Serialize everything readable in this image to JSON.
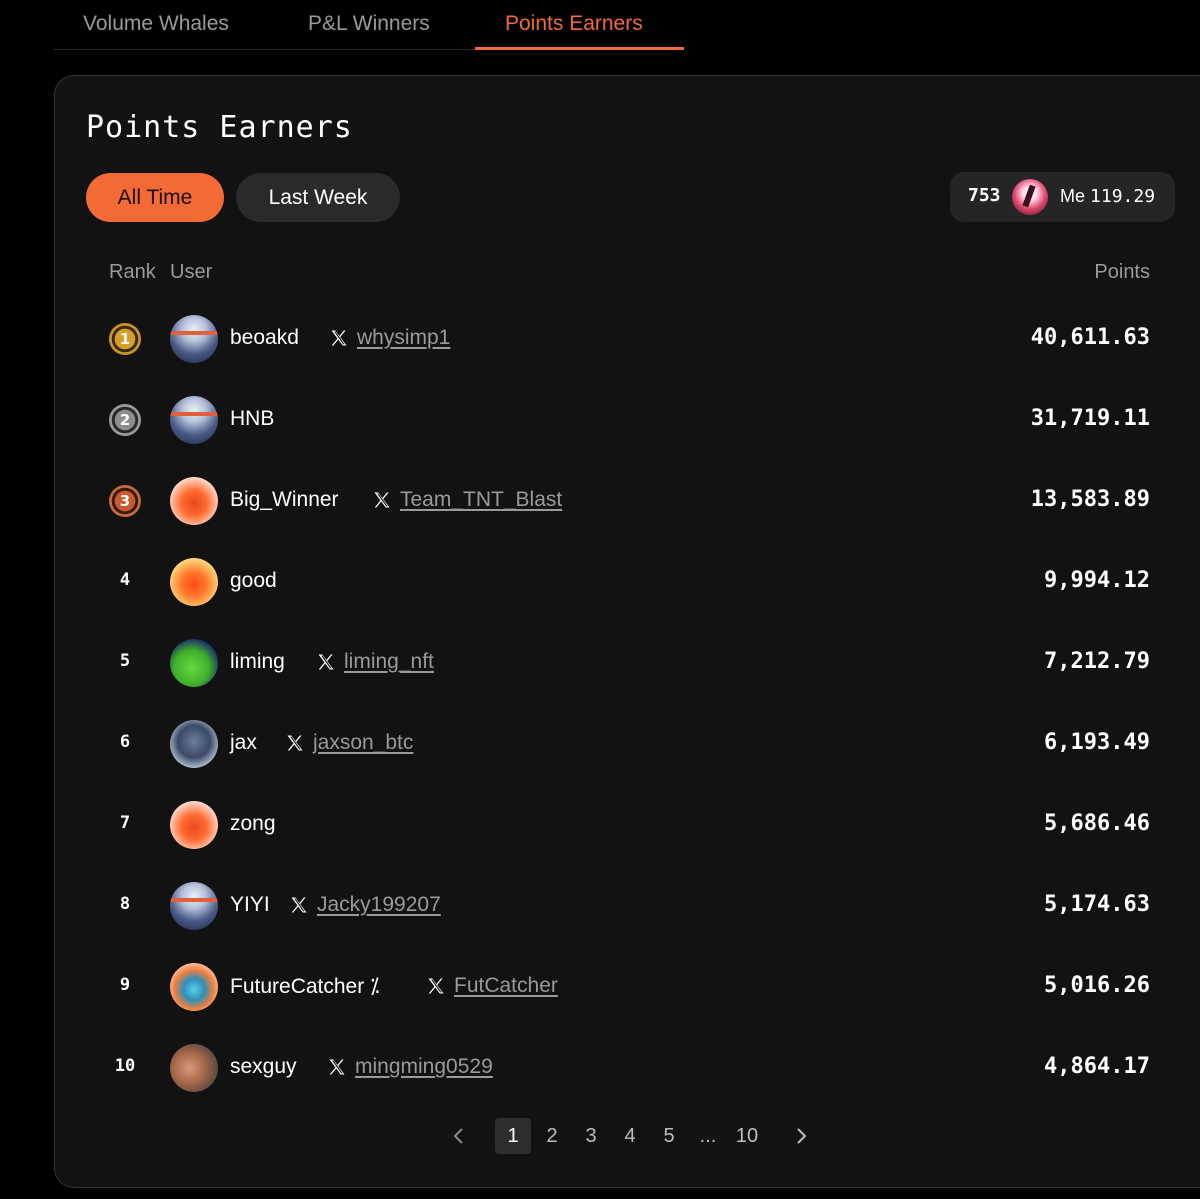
{
  "tabs": [
    {
      "label": "Volume Whales",
      "active": false
    },
    {
      "label": "P&L Winners",
      "active": false
    },
    {
      "label": "Points Earners",
      "active": true
    }
  ],
  "accent_color": "#f26a35",
  "card": {
    "title": "Points Earners",
    "filters": {
      "all_time": "All Time",
      "last_week": "Last Week",
      "selected": "All Time"
    },
    "me": {
      "rank": "753",
      "label": "Me",
      "score": "119.29"
    },
    "columns": {
      "rank": "Rank",
      "user": "User",
      "points": "Points"
    }
  },
  "rows": [
    {
      "rank": "1",
      "medal": "gold",
      "avatar": "ghost",
      "name": "beoakd",
      "x_handle": "whysimp1",
      "points": "40,611.63"
    },
    {
      "rank": "2",
      "medal": "silver",
      "avatar": "ghost",
      "name": "HNB",
      "x_handle": "",
      "points": "31,719.11"
    },
    {
      "rank": "3",
      "medal": "bronze",
      "avatar": "red-silhouette",
      "name": "Big_Winner",
      "x_handle": "Team_TNT_Blast",
      "points": "13,583.89"
    },
    {
      "rank": "4",
      "medal": "",
      "avatar": "yellow-silhouette",
      "name": "good",
      "x_handle": "",
      "points": "9,994.12"
    },
    {
      "rank": "5",
      "medal": "",
      "avatar": "frog",
      "name": "liming",
      "x_handle": "liming_nft",
      "points": "7,212.79"
    },
    {
      "rank": "6",
      "medal": "",
      "avatar": "spy",
      "name": "jax",
      "x_handle": "jaxson_btc",
      "points": "6,193.49"
    },
    {
      "rank": "7",
      "medal": "",
      "avatar": "red-silhouette",
      "name": "zong",
      "x_handle": "",
      "points": "5,686.46"
    },
    {
      "rank": "8",
      "medal": "",
      "avatar": "ghost",
      "name": "YIYI",
      "x_handle": "Jacky199207",
      "points": "5,174.63"
    },
    {
      "rank": "9",
      "medal": "",
      "avatar": "cat",
      "name": "FutureCatcher ⁒",
      "x_handle": "FutCatcher",
      "points": "5,016.26"
    },
    {
      "rank": "10",
      "medal": "",
      "avatar": "face-photo",
      "name": "sexguy",
      "x_handle": "mingming0529",
      "points": "4,864.17"
    }
  ],
  "pagination": {
    "prev_icon": "chevron-left-icon",
    "pages": [
      "1",
      "2",
      "3",
      "4",
      "5",
      "...",
      "10"
    ],
    "current": "1",
    "next_icon": "chevron-right-icon"
  }
}
